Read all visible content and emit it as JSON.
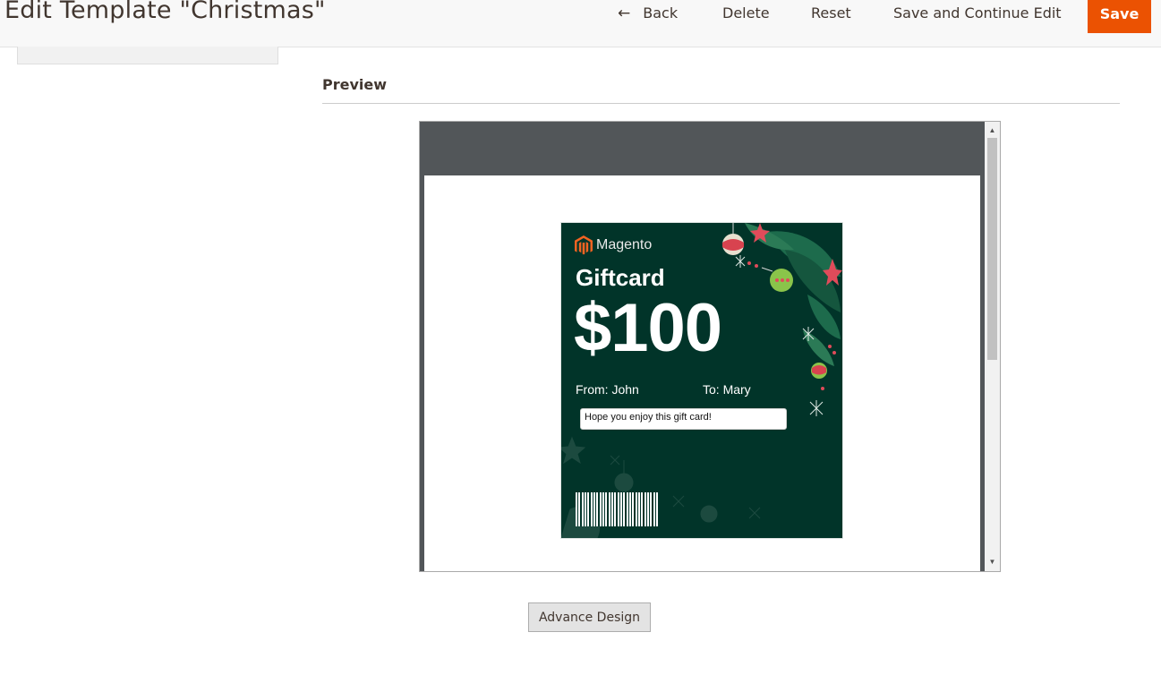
{
  "header": {
    "title": "Edit Template \"Christmas\"",
    "back_label": "Back",
    "delete_label": "Delete",
    "reset_label": "Reset",
    "save_continue_label": "Save and Continue Edit",
    "save_label": "Save",
    "accent_color": "#eb5202"
  },
  "preview": {
    "section_title": "Preview",
    "card": {
      "brand": "Magento",
      "title": "Giftcard",
      "amount": "$100",
      "from": "From: John",
      "to": "To: Mary",
      "message": "Hope you enjoy this gift card!",
      "background_color": "#013429"
    }
  },
  "actions": {
    "advance_design_label": "Advance Design"
  }
}
